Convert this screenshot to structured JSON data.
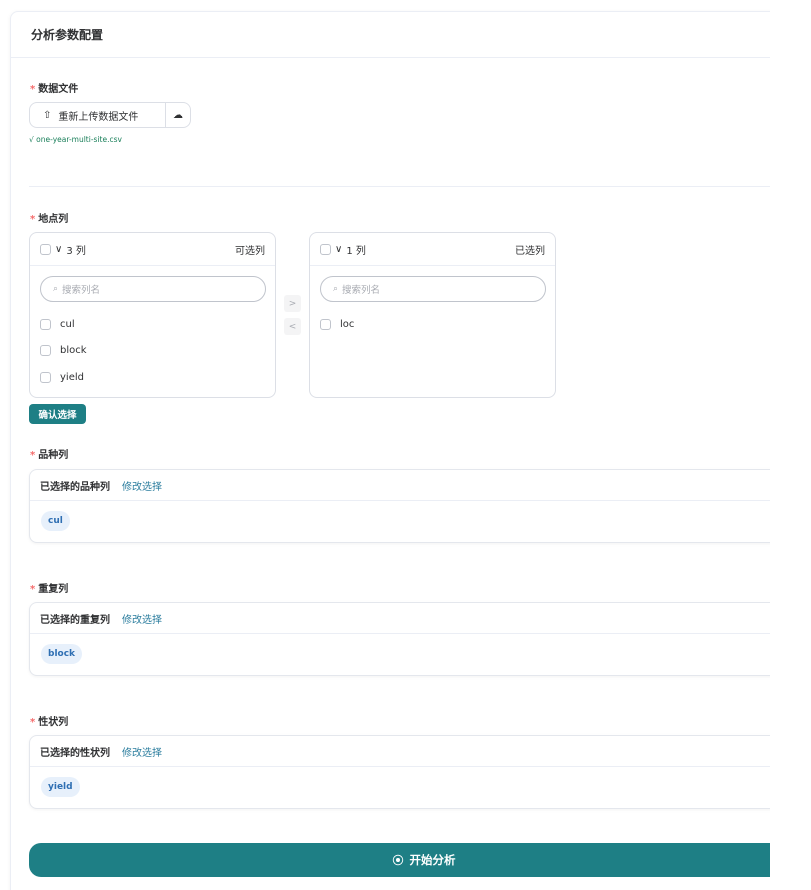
{
  "header": {
    "title": "分析参数配置"
  },
  "required_mark": "*",
  "data_file": {
    "label": "数据文件",
    "reupload_label": "重新上传数据文件",
    "upload_icon": "upload-icon",
    "cloud_icon": "cloud-icon",
    "check_mark": "√",
    "uploaded_file": "one-year-multi-site.csv"
  },
  "location": {
    "label": "地点列",
    "search_placeholder": "搜索列名",
    "left": {
      "count": "3 列",
      "title": "可选列",
      "items": [
        "cul",
        "block",
        "yield"
      ]
    },
    "right": {
      "count": "1 列",
      "title": "已选列",
      "items": [
        "loc"
      ]
    },
    "to_right_arrow": ">",
    "to_left_arrow": "<",
    "confirm_label": "确认选择"
  },
  "variety": {
    "label": "品种列",
    "selected_title": "已选择的品种列",
    "modify_label": "修改选择",
    "tag": "cul"
  },
  "replicate": {
    "label": "重复列",
    "selected_title": "已选择的重复列",
    "modify_label": "修改选择",
    "tag": "block"
  },
  "trait": {
    "label": "性状列",
    "selected_title": "已选择的性状列",
    "modify_label": "修改选择",
    "tag": "yield"
  },
  "start": {
    "label": "开始分析",
    "icon": "play-circle-icon"
  },
  "colors": {
    "accent": "#1e7f85",
    "required": "#f56c6c",
    "success": "#1a7f5a",
    "link": "#2b7d9e",
    "tag_bg": "#e7f0fb",
    "tag_text": "#2f6fb3"
  }
}
